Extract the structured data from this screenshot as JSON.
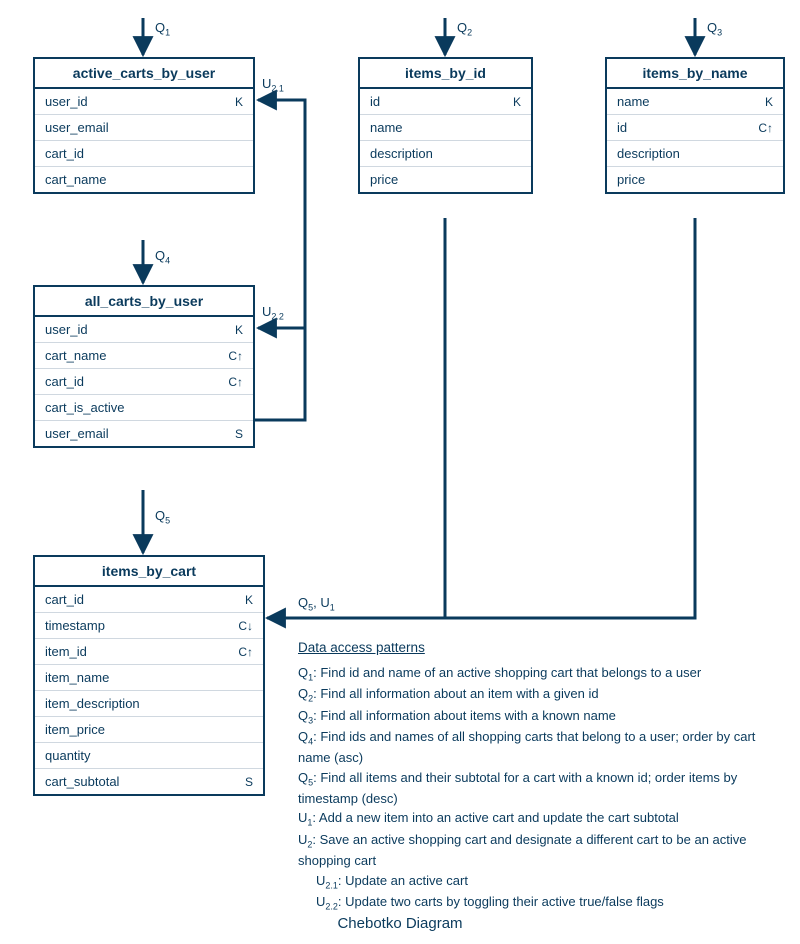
{
  "caption": "Chebotko Diagram",
  "labels": {
    "q1": "Q",
    "q1s": "1",
    "q2": "Q",
    "q2s": "2",
    "q3": "Q",
    "q3s": "3",
    "q4": "Q",
    "q4s": "4",
    "q5a": "Q",
    "q5as": "5",
    "u21": "U",
    "u21s": "2.1",
    "u22": "U",
    "u22s": "2.2",
    "q5u1_q": "Q",
    "q5u1_qs": "5",
    "q5u1_sep": ", ",
    "q5u1_u": "U",
    "q5u1_us": "1"
  },
  "tables": {
    "t1": {
      "title": "active_carts_by_user",
      "rows": [
        {
          "name": "user_id",
          "ann": "K"
        },
        {
          "name": "user_email",
          "ann": ""
        },
        {
          "name": "cart_id",
          "ann": ""
        },
        {
          "name": "cart_name",
          "ann": ""
        }
      ]
    },
    "t2": {
      "title": "items_by_id",
      "rows": [
        {
          "name": "id",
          "ann": "K"
        },
        {
          "name": "name",
          "ann": ""
        },
        {
          "name": "description",
          "ann": ""
        },
        {
          "name": "price",
          "ann": ""
        }
      ]
    },
    "t3": {
      "title": "items_by_name",
      "rows": [
        {
          "name": "name",
          "ann": "K"
        },
        {
          "name": "id",
          "ann": "C↑"
        },
        {
          "name": "description",
          "ann": ""
        },
        {
          "name": "price",
          "ann": ""
        }
      ]
    },
    "t4": {
      "title": "all_carts_by_user",
      "rows": [
        {
          "name": "user_id",
          "ann": "K"
        },
        {
          "name": "cart_name",
          "ann": "C↑"
        },
        {
          "name": "cart_id",
          "ann": "C↑"
        },
        {
          "name": "cart_is_active",
          "ann": ""
        },
        {
          "name": "user_email",
          "ann": "S"
        }
      ]
    },
    "t5": {
      "title": "items_by_cart",
      "rows": [
        {
          "name": "cart_id",
          "ann": "K"
        },
        {
          "name": "timestamp",
          "ann": "C↓"
        },
        {
          "name": "item_id",
          "ann": "C↑"
        },
        {
          "name": "item_name",
          "ann": ""
        },
        {
          "name": "item_description",
          "ann": ""
        },
        {
          "name": "item_price",
          "ann": ""
        },
        {
          "name": "quantity",
          "ann": ""
        },
        {
          "name": "cart_subtotal",
          "ann": "S"
        }
      ]
    }
  },
  "patterns": {
    "title": "Data access patterns",
    "items": [
      {
        "key": "Q",
        "sub": "1",
        "text": ": Find id and name of an active shopping cart that belongs to a user"
      },
      {
        "key": "Q",
        "sub": "2",
        "text": ": Find all information about an item with a given id"
      },
      {
        "key": "Q",
        "sub": "3",
        "text": ": Find all information about items with a known name"
      },
      {
        "key": "Q",
        "sub": "4",
        "text": ": Find ids and names of all shopping carts that belong to a user; order by cart name (asc)"
      },
      {
        "key": "Q",
        "sub": "5",
        "text": ": Find all items and their subtotal for a cart with a known id; order items by timestamp (desc)"
      },
      {
        "key": "U",
        "sub": "1",
        "text": ": Add a new item into an active cart and update the cart subtotal"
      },
      {
        "key": "U",
        "sub": "2",
        "text": ": Save an active shopping cart and designate a different cart to be an active shopping cart"
      },
      {
        "key": "U",
        "sub": "2.1",
        "text": ": Update an active cart",
        "indent": true
      },
      {
        "key": "U",
        "sub": "2.2",
        "text": ": Update two carts by toggling their active true/false flags",
        "indent": true
      }
    ]
  }
}
